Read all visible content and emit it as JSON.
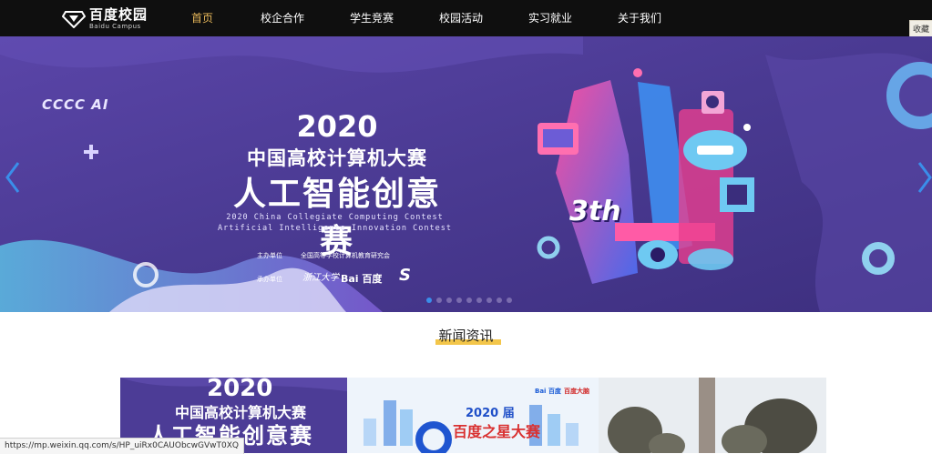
{
  "header": {
    "logo_cn": "百度校园",
    "logo_en": "Baidu Campus",
    "nav": [
      {
        "label": "首页",
        "active": true
      },
      {
        "label": "校企合作",
        "active": false
      },
      {
        "label": "学生竞赛",
        "active": false
      },
      {
        "label": "校园活动",
        "active": false
      },
      {
        "label": "实习就业",
        "active": false
      },
      {
        "label": "关于我们",
        "active": false
      }
    ],
    "bookmark_label": "收藏"
  },
  "banner": {
    "brand": "CCCC AI",
    "year": "2020",
    "contest_cn": "中国高校计算机大赛",
    "track_cn": "人工智能创意赛",
    "contest_en_1": "2020 China Collegiate Computing Contest",
    "contest_en_2": "Artificial Intelligence Innovation Contest",
    "host_label": "主办单位",
    "host_value": "全国高等学校计算机教育研究会",
    "organizer_label": "承办单位",
    "organizers": [
      "浙江大学",
      "Bai 百度",
      "S"
    ],
    "edition": "3th",
    "slide_count": 9,
    "active_slide": 0
  },
  "news": {
    "section_title": "新闻资讯",
    "cards": [
      {
        "year": "2020",
        "contest": "中国高校计算机大赛",
        "track": "人工智能创意赛"
      },
      {
        "logo_1": "Bai 百度",
        "logo_2": "百度大脑",
        "year": "2020 届",
        "name": "百度之星大赛"
      },
      {}
    ]
  },
  "status_bar": {
    "url": "https://mp.weixin.qq.com/s/HP_uiRx0CAUObcwGVwT0XQ"
  },
  "colors": {
    "nav_bg": "#0f0f0f",
    "nav_active": "#e8b85a",
    "banner_bg": "#4a3a8f",
    "dot_active": "#3a8eea",
    "highlight": "#f3c64a"
  }
}
